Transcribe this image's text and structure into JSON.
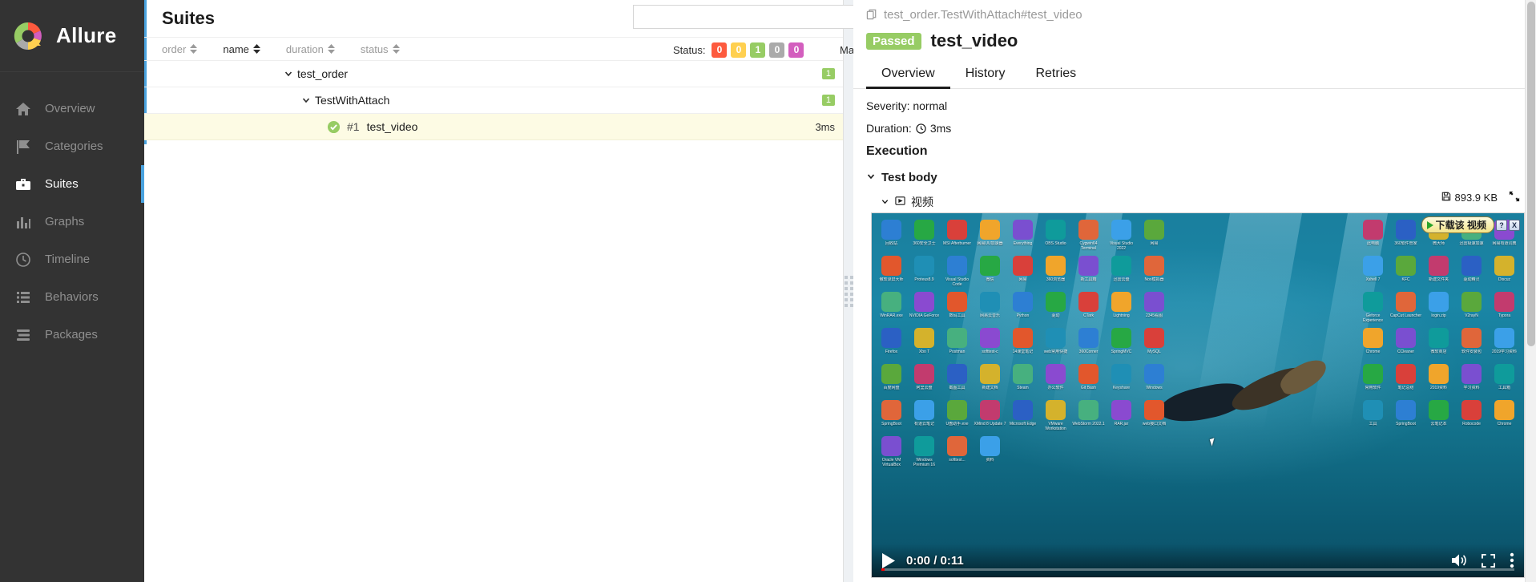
{
  "sidebar": {
    "brand": "Allure",
    "items": [
      {
        "label": "Overview",
        "icon": "home-icon",
        "active": false
      },
      {
        "label": "Categories",
        "icon": "flag-icon",
        "active": false
      },
      {
        "label": "Suites",
        "icon": "briefcase-icon",
        "active": true
      },
      {
        "label": "Graphs",
        "icon": "bar-chart-icon",
        "active": false
      },
      {
        "label": "Timeline",
        "icon": "clock-icon",
        "active": false
      },
      {
        "label": "Behaviors",
        "icon": "list-icon",
        "active": false
      },
      {
        "label": "Packages",
        "icon": "layers-icon",
        "active": false
      }
    ]
  },
  "suites": {
    "title": "Suites",
    "search_placeholder": "",
    "search_value": "",
    "head_icons": [
      {
        "name": "info-icon"
      },
      {
        "name": "download-icon"
      }
    ],
    "sorters": [
      {
        "label": "order",
        "active": false
      },
      {
        "label": "name",
        "active": true
      },
      {
        "label": "duration",
        "active": false
      },
      {
        "label": "status",
        "active": false
      }
    ],
    "status": {
      "label": "Status:",
      "chips": [
        {
          "value": "0",
          "color": "#fd5a3e",
          "name": "failed"
        },
        {
          "value": "0",
          "color": "#ffd050",
          "name": "broken"
        },
        {
          "value": "1",
          "color": "#97cc64",
          "name": "passed"
        },
        {
          "value": "0",
          "color": "#aaaaaa",
          "name": "skipped"
        },
        {
          "value": "0",
          "color": "#d35ebe",
          "name": "unknown"
        }
      ]
    },
    "marks": {
      "label": "Marks:",
      "buttons": [
        {
          "name": "flaky-icon"
        },
        {
          "name": "x-circle-icon"
        },
        {
          "name": "check-circle-icon"
        },
        {
          "name": "exclamation-circle-icon"
        },
        {
          "name": "retry-icon"
        }
      ]
    },
    "tree": [
      {
        "level": 0,
        "name": "test_order",
        "count": "1",
        "expanded": true,
        "type": "suite"
      },
      {
        "level": 1,
        "name": "TestWithAttach",
        "count": "1",
        "expanded": true,
        "type": "class"
      },
      {
        "level": 2,
        "name": "test_video",
        "number": "#1",
        "duration": "3ms",
        "status": "passed",
        "selected": true,
        "type": "test"
      }
    ]
  },
  "detail": {
    "breadcrumb": "test_order.TestWithAttach#test_video",
    "breadcrumb_icon": "copy-icon",
    "status_badge": "Passed",
    "title": "test_video",
    "tabs": [
      {
        "label": "Overview",
        "active": true
      },
      {
        "label": "History",
        "active": false
      },
      {
        "label": "Retries",
        "active": false
      }
    ],
    "severity": "Severity: normal",
    "duration_label": "Duration:",
    "duration_value": "3ms",
    "execution_heading": "Execution",
    "test_body_label": "Test body",
    "attachment": {
      "name": "视频",
      "icon": "video-file-icon",
      "size": "893.9 KB",
      "size_icon": "save-icon",
      "expand_icon": "fullscreen-icon"
    }
  },
  "video": {
    "current_time": "0:00",
    "total_time": "0:11",
    "time_display": "0:00 / 0:11",
    "progress_percent": 0,
    "controls": [
      {
        "name": "play-button"
      },
      {
        "name": "volume-button"
      },
      {
        "name": "fullscreen-button"
      },
      {
        "name": "more-options-button"
      }
    ],
    "overlay": {
      "download_label": "下载该 视频",
      "help_label": "?",
      "close_label": "X"
    },
    "desktop_icons": [
      "回收站",
      "360安全卫士",
      "MSI Afterburner",
      "网易UU加速器",
      "Everything",
      "OBS Studio",
      "Cygwin64 Terminal",
      "Visual Studio 2022",
      "网易",
      "此电脑",
      "360软件管家",
      "微大师",
      "迅雷极速加速",
      "网易有道词典",
      "傲软录屏大师",
      "Proteus8.9",
      "Visual Studio Code",
      "微信",
      "网易",
      "360浏览器",
      "新工具箱",
      "迅雷云盘",
      "Nox模拟器",
      "Xshell 7",
      "KFC",
      "新建文件夹",
      "驱动精灵",
      "Discuz",
      "WinRAR.exe",
      "NVIDIA GeForce",
      "数码工具",
      "网易云音乐",
      "Python",
      "驱动",
      "CTark",
      "Lightning",
      "2345看图",
      "Geforce Experience",
      "CapCut Launcher",
      "login.zip",
      "V2rayN",
      "Typora",
      "Firefox",
      "Xbo T",
      "Postman",
      "softtest-c",
      "14课堂笔记",
      "web常用快捷",
      "360Corner",
      "SpringMVC",
      "MySQL",
      "Chrome",
      "CCleaner",
      "微软商店",
      "软件安装包",
      "2019学习资料",
      "百度网盘",
      "阿里云盘",
      "截图工具",
      "新建文档",
      "Steam",
      "办公软件",
      "Git Bash",
      "Keyshare",
      "Windows",
      "常用软件",
      "笔记总结",
      "2019资料",
      "学习资料",
      "工具箱",
      "SpringBoot",
      "有道云笔记",
      "U盘助手.exe",
      "XMind 8 Update 7",
      "Microsoft Edge",
      "VMware Workstation",
      "WebStorm 2022.1",
      "RAR.jar",
      "web接口文档",
      "工具",
      "SpringBoot",
      "云笔记本",
      "Robocode",
      "Chrome",
      "Oracle VM VirtualBox",
      "Windows Premium 16",
      "softtest...",
      "资料"
    ]
  }
}
